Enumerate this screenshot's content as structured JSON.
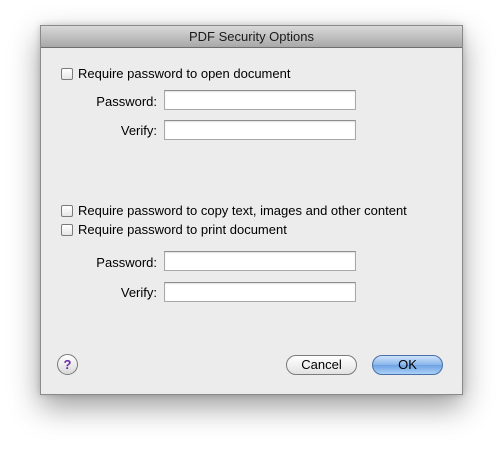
{
  "dialog": {
    "title": "PDF Security Options",
    "open_section": {
      "checkbox_label": "Require password to open document",
      "checked": false,
      "password_label": "Password:",
      "password_value": "",
      "verify_label": "Verify:",
      "verify_value": ""
    },
    "permissions_section": {
      "copy_checkbox_label": "Require password to copy text, images and other content",
      "copy_checked": false,
      "print_checkbox_label": "Require password to print document",
      "print_checked": false,
      "password_label": "Password:",
      "password_value": "",
      "verify_label": "Verify:",
      "verify_value": ""
    },
    "buttons": {
      "help_label": "?",
      "cancel_label": "Cancel",
      "ok_label": "OK"
    }
  },
  "colors": {
    "dialog_bg": "#ececec",
    "default_button": "#88b5ec",
    "help_glyph": "#6b2ca6"
  },
  "icons": {
    "help": "question-mark-icon"
  }
}
